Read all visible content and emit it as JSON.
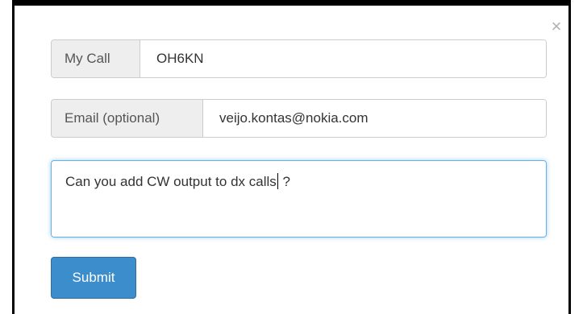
{
  "modal": {
    "close_glyph": "×"
  },
  "form": {
    "call_label": "My Call",
    "call_value": "OH6KN",
    "email_label": "Email (optional)",
    "email_value": "veijo.kontas@nokia.com",
    "message_before_caret": "Can you add CW output to dx calls",
    "message_after_caret": " ?",
    "submit_label": "Submit"
  },
  "colors": {
    "addon_bg": "#eeeeee",
    "focus_border": "#66afe9",
    "submit_bg": "#3c8dcb"
  }
}
